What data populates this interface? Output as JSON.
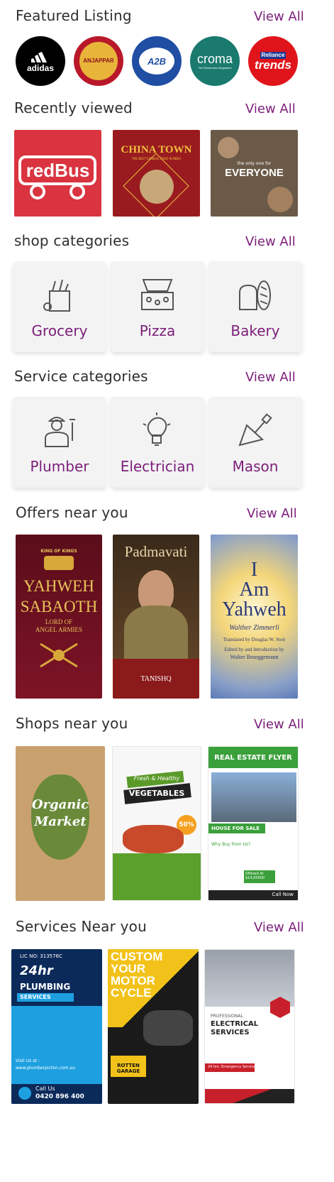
{
  "featured": {
    "title": "Featured Listing",
    "view_all": "View All",
    "brands": [
      {
        "name": "adidas",
        "icon": "adidas-logo",
        "bg": "#000000"
      },
      {
        "name": "ANJAPPAR",
        "icon": "anjappar-logo",
        "bg": "#b8182a"
      },
      {
        "name": "A2B",
        "icon": "a2b-logo",
        "bg": "#1f4ea3"
      },
      {
        "name": "croma",
        "sub": "The Electronics Megastore",
        "icon": "croma-logo",
        "bg": "#1a7a6e"
      },
      {
        "name": "trends",
        "top": "Reliance",
        "icon": "reliance-trends-logo",
        "bg": "#e0151b"
      }
    ]
  },
  "recent": {
    "title": "Recently viewed",
    "view_all": "View All",
    "items": [
      {
        "label": "redBus"
      },
      {
        "label": "CHINA TOWN",
        "sub": "THE BEST CHINESE FOOD IN INDIA"
      },
      {
        "label": "EVERYONE",
        "sub": "the only one for"
      }
    ]
  },
  "shop_categories": {
    "title": "shop categories",
    "view_all": "View All",
    "items": [
      {
        "label": "Grocery",
        "icon": "grocery-bag-icon"
      },
      {
        "label": "Pizza",
        "icon": "pizza-box-icon"
      },
      {
        "label": "Bakery",
        "icon": "bakery-bread-icon"
      }
    ]
  },
  "service_categories": {
    "title": "Service categories",
    "view_all": "View All",
    "items": [
      {
        "label": "Plumber",
        "icon": "plumber-icon"
      },
      {
        "label": "Electrician",
        "icon": "lightbulb-icon"
      },
      {
        "label": "Mason",
        "icon": "trowel-icon"
      }
    ]
  },
  "offers": {
    "title": "Offers near you",
    "view_all": "View All",
    "items": [
      {
        "line1": "YAHWEH",
        "line2": "SABAOTH",
        "line3": "LORD OF",
        "line4": "ANGEL ARMIES",
        "crown": "KING OF KINGS"
      },
      {
        "title": "Padmavati",
        "brand": "TANISHQ"
      },
      {
        "l1": "I",
        "l2": "Am",
        "l3": "Yahweh",
        "author": "Walther Zimmerli",
        "tr": "Translated by Douglas W. Stott",
        "ed": "Edited by and Introduction by",
        "ed2": "Walter Brueggemann"
      }
    ]
  },
  "shops": {
    "title": "Shops near you",
    "view_all": "View All",
    "items": [
      {
        "l1": "Organic",
        "l2": "Market"
      },
      {
        "l1": "Fresh & Healthy",
        "l2": "VEGETABLES",
        "badge": "50%"
      },
      {
        "l1": "REAL ESTATE FLYER",
        "l2": "HOUSE FOR SALE",
        "l3": "Why Buy from Us?",
        "l4": "Offered At $14,00000",
        "l5": "Call Now"
      }
    ]
  },
  "services": {
    "title": "Services Near you",
    "view_all": "View All",
    "items": [
      {
        "lic": "LIC NO: 313576C",
        "l1": "24hr",
        "l2": "PLUMBING",
        "l3": "SERVICES",
        "visit": "Visit Us at :",
        "url": "www.plumberpicton.com.au",
        "call": "Call Us",
        "phone": "0420 896 400"
      },
      {
        "l1": "CUSTOM",
        "l2": "YOUR",
        "l3": "MOTOR",
        "l4": "CYCLE",
        "brand": "ROTTEN GARAGE"
      },
      {
        "l1": "PROFESSIONAL",
        "l2": "ELECTRICAL",
        "l3": "SERVICES",
        "l4": "24 hrs. Emergency Services"
      }
    ]
  }
}
